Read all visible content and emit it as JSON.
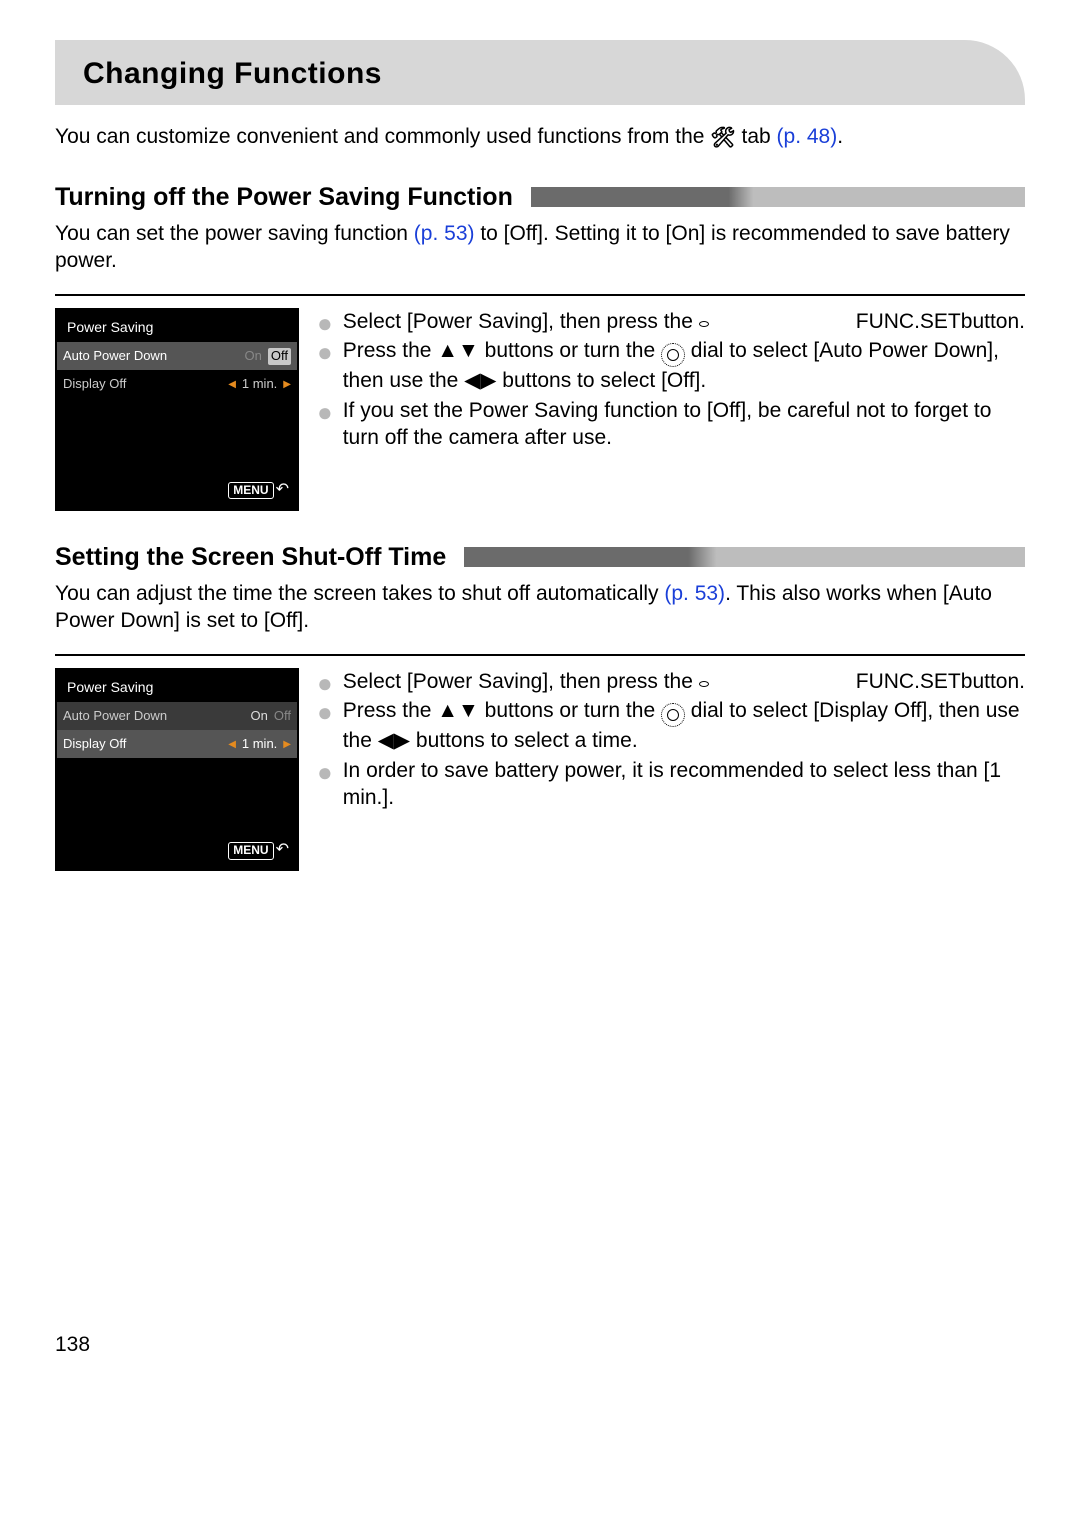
{
  "page_title": "Changing Functions",
  "intro": {
    "text_a": "You can customize convenient and commonly used functions from the ",
    "text_b": " tab ",
    "ref": "(p. 48)",
    "period": "."
  },
  "section1": {
    "title": "Turning off the Power Saving Function",
    "para_a": "You can set the power saving function ",
    "ref": "(p. 53)",
    "para_b": " to [Off]. Setting it to [On] is recommended to save battery power.",
    "lcd": {
      "title": "Power Saving",
      "row1_label": "Auto Power Down",
      "row1_on": "On",
      "row1_off": "Off",
      "row2_label": "Display Off",
      "row2_val": "1 min.",
      "menu": "MENU"
    },
    "b1_a": "Select [Power Saving], then press the ",
    "b1_b": " button.",
    "b2_a": "Press the ",
    "b2_b": " buttons or turn the ",
    "b2_c": " dial to select [Auto Power Down], then use the ",
    "b2_d": " buttons to select [Off].",
    "b3": "If you set the Power Saving function to [Off], be careful not to forget to turn off the camera after use."
  },
  "section2": {
    "title": "Setting the Screen Shut-Off Time",
    "para_a": "You can adjust the time the screen takes to shut off automatically ",
    "ref": "(p. 53)",
    "para_b": ". This also works when [Auto Power Down] is set to [Off].",
    "lcd": {
      "title": "Power Saving",
      "row1_label": "Auto Power Down",
      "row1_on": "On",
      "row1_off": "Off",
      "row2_label": "Display Off",
      "row2_val": "1 min.",
      "menu": "MENU"
    },
    "b1_a": "Select [Power Saving], then press the ",
    "b1_b": " button.",
    "b2_a": "Press the ",
    "b2_b": " buttons or turn the ",
    "b2_c": " dial to select [Display Off], then use the ",
    "b2_d": " buttons to select a time.",
    "b3": "In order to save battery power, it is recommended to select less than [1 min.]."
  },
  "icons": {
    "func_top": "FUNC.",
    "func_bot": "SET",
    "up_down": "▲▼",
    "left_right": "◀▶"
  },
  "page_number": "138"
}
